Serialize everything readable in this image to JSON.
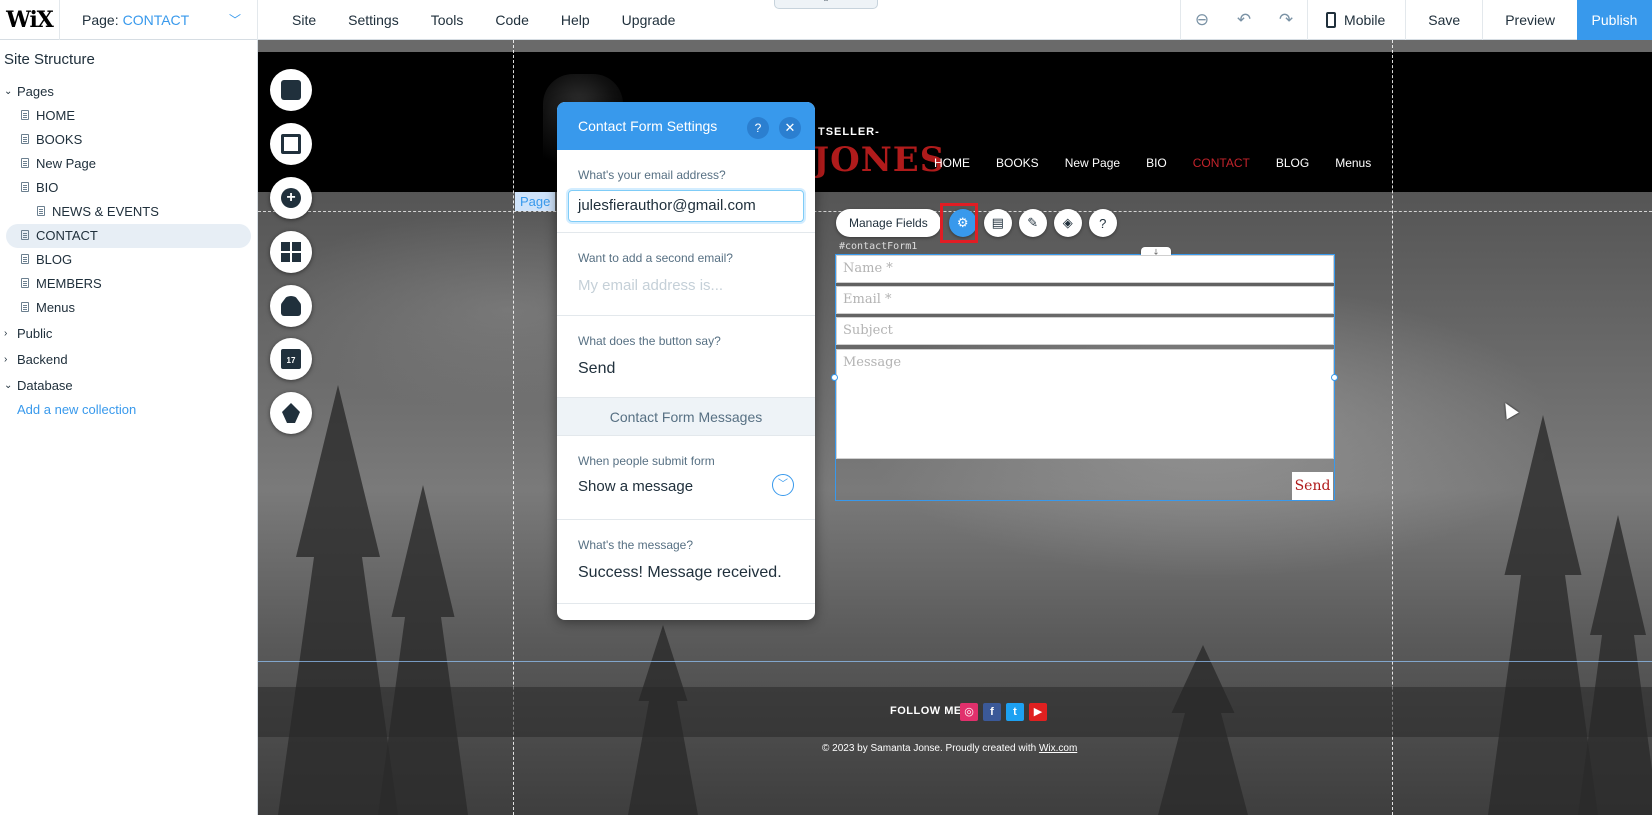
{
  "topbar": {
    "logo": "WiX",
    "page_label": "Page:",
    "page_value": "CONTACT",
    "menu": [
      "Site",
      "Settings",
      "Tools",
      "Code",
      "Help",
      "Upgrade"
    ],
    "mobile": "Mobile",
    "save": "Save",
    "preview": "Preview",
    "publish": "Publish"
  },
  "sidebar": {
    "title": "Site Structure",
    "pages_label": "Pages",
    "pages": [
      "HOME",
      "BOOKS",
      "New Page",
      "BIO",
      "NEWS & EVENTS",
      "CONTACT",
      "BLOG",
      "MEMBERS",
      "Menus"
    ],
    "public": "Public",
    "backend": "Backend",
    "database": "Database",
    "add_collection": "Add a new collection"
  },
  "site": {
    "tagline": "TSELLER-",
    "author": "JONES",
    "nav": [
      "HOME",
      "BOOKS",
      "New Page",
      "BIO",
      "CONTACT",
      "BLOG",
      "Menus"
    ],
    "page_tag": "Page",
    "follow": "FOLLOW ME",
    "copyright": "© 2023 by Samanta Jonse. Proudly created with",
    "wix_link": "Wix.com"
  },
  "panel": {
    "title": "Contact Form Settings",
    "email_q": "What's your email address?",
    "email_value": "julesfierauthor@gmail.com",
    "second_q": "Want to add a second email?",
    "second_placeholder": "My email address is...",
    "button_q": "What does the button say?",
    "button_value": "Send",
    "messages_header": "Contact Form Messages",
    "submit_q": "When people submit form",
    "submit_value": "Show a message",
    "message_q": "What's the message?",
    "message_value": "Success! Message received."
  },
  "form": {
    "toolbar_manage": "Manage Fields",
    "id": "#contactForm1",
    "name": "Name *",
    "email": "Email *",
    "subject": "Subject",
    "message": "Message",
    "send": "Send"
  },
  "colors": {
    "accent": "#3899ec",
    "brand_red": "#b01b1b",
    "highlight": "#e11d24"
  }
}
